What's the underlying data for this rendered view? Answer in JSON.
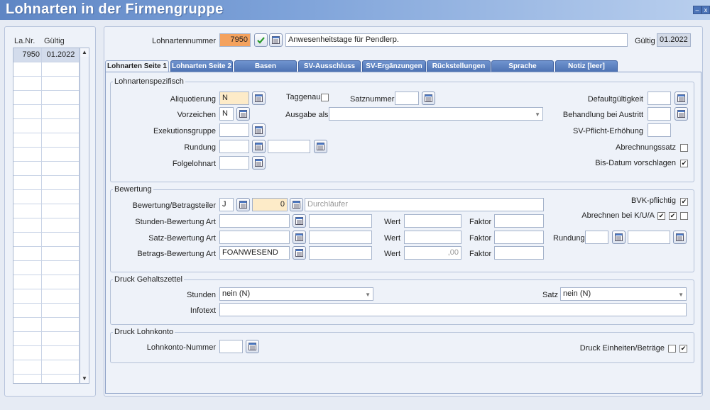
{
  "window": {
    "title": "Lohnarten in der Firmengruppe",
    "minimize_glyph": "–",
    "close_glyph": "x"
  },
  "list": {
    "col_nr": "La.Nr.",
    "col_gueltig": "Gültig",
    "rows": [
      {
        "nr": "7950",
        "gueltig": "01.2022"
      }
    ],
    "scroll_up": "▲",
    "scroll_down": "▼"
  },
  "header": {
    "lohnartennummer_label": "Lohnartennummer",
    "lohnartennummer_value": "7950",
    "description_value": "Anwesenheitstage für Pendlerp.",
    "gueltig_label": "Gültig",
    "gueltig_value": "01.2022"
  },
  "tabs": [
    "Lohnarten Seite 1",
    "Lohnarten Seite 2",
    "Basen",
    "SV-Ausschluss",
    "SV-Ergänzungen",
    "Rückstellungen",
    "Sprache",
    "Notiz [leer]"
  ],
  "spezifisch": {
    "title": "Lohnartenspezifisch",
    "aliquotierung_label": "Aliquotierung",
    "aliquotierung_value": "N",
    "vorzeichen_label": "Vorzeichen",
    "vorzeichen_value": "N",
    "exekutionsgruppe_label": "Exekutionsgruppe",
    "rundung_label": "Rundung",
    "folgelohnart_label": "Folgelohnart",
    "taggenau_label": "Taggenau",
    "satznummer_label": "Satznummer",
    "ausgabe_als_label": "Ausgabe als",
    "defaultgueltigkeit_label": "Defaultgültigkeit",
    "behandlung_label": "Behandlung bei Austritt",
    "sv_pflicht_label": "SV-Pflicht-Erhöhung",
    "abrechnungssatz_label": "Abrechnungssatz",
    "bis_datum_label": "Bis-Datum vorschlagen",
    "checkmark": "✔"
  },
  "bewertung": {
    "title": "Bewertung",
    "betragsteiler_label": "Bewertung/Betragsteiler",
    "betragsteiler_value": "J",
    "betragsteiler_number": "0",
    "betragsteiler_text": "Durchläufer",
    "stunden_label": "Stunden-Bewertung Art",
    "satz_label": "Satz-Bewertung Art",
    "betrags_label": "Betrags-Bewertung Art",
    "betrags_value": "FOANWESEND",
    "wert_label": "Wert",
    "faktor_label": "Faktor",
    "wert_betrags_value": ",00",
    "bvk_label": "BVK-pflichtig",
    "abrechnen_label": "Abrechnen bei K/U/A",
    "rundung_label": "Rundung"
  },
  "gehaltszettel": {
    "title": "Druck Gehaltszettel",
    "stunden_label": "Stunden",
    "stunden_value": "nein (N)",
    "satz_label": "Satz",
    "satz_value": "nein (N)",
    "infotext_label": "Infotext"
  },
  "lohnkonto": {
    "title": "Druck Lohnkonto",
    "nummer_label": "Lohnkonto-Nummer",
    "druck_label": "Druck Einheiten/Beträge"
  },
  "colors": {
    "titlebar": "#6b90cd",
    "tab": "#5a7fc0",
    "accent_orange": "#f4a25e",
    "accent_yellow": "#fdebc8"
  }
}
